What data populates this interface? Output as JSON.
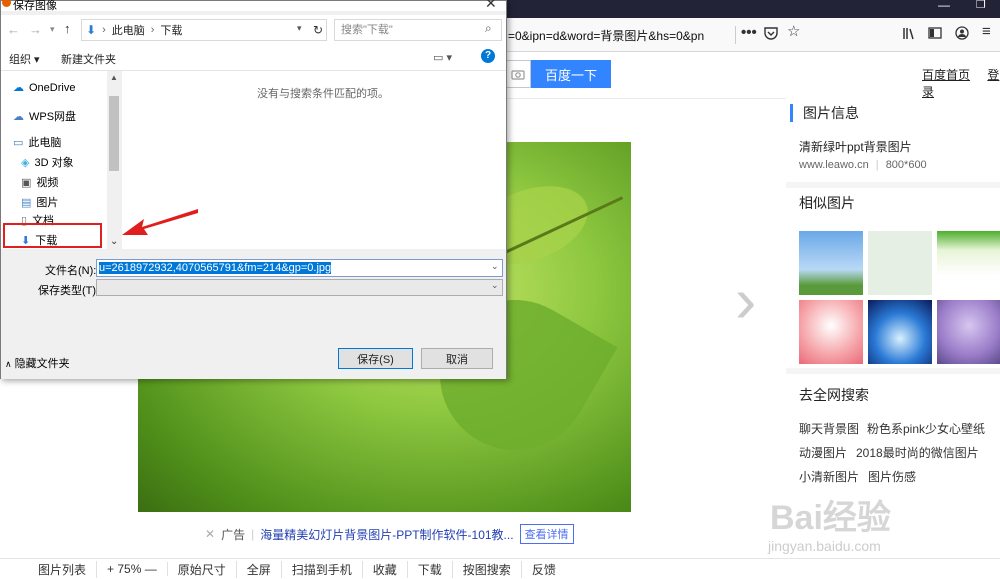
{
  "browser": {
    "url_tail": "=0&ipn=d&word=背景图片&hs=0&pn",
    "more_icon": "ellipsis-icon"
  },
  "page": {
    "search_button": "百度一下",
    "top_links": [
      "百度首页",
      "登录"
    ],
    "ad": {
      "label": "广告",
      "link": "海量精美幻灯片背景图片-PPT制作软件-101教...",
      "button": "查看详情"
    },
    "bottom_bar": [
      "图片列表",
      "+ 75% —",
      "原始尺寸",
      "全屏",
      "扫描到手机",
      "收藏",
      "下载",
      "按图搜索",
      "反馈"
    ]
  },
  "right_panel": {
    "info_title": "图片信息",
    "image_name": "清新绿叶ppt背景图片",
    "source": "www.leawo.cn",
    "size": "800*600",
    "similar_title": "相似图片",
    "search_title": "去全网搜索",
    "tags": [
      "聊天背景图",
      "粉色系pink少女心壁纸",
      "动漫图片",
      "2018最时尚的微信图片",
      "小清新图片",
      "图片伤感"
    ]
  },
  "dialog": {
    "title": "保存图像",
    "path": [
      "此电脑",
      "下载"
    ],
    "search_placeholder": "搜索\"下载\"",
    "toolbar": {
      "organize": "组织 ▾",
      "new_folder": "新建文件夹"
    },
    "nav_items": [
      "OneDrive",
      "WPS网盘",
      "此电脑",
      "3D 对象",
      "视频",
      "图片",
      "文档",
      "下载"
    ],
    "empty_message": "没有与搜索条件匹配的项。",
    "filename_label": "文件名(N):",
    "filename_value": "u=2618972932,4070565791&fm=214&gp=0.jpg",
    "filetype_label": "保存类型(T):",
    "save_button": "保存(S)",
    "cancel_button": "取消",
    "hide_folders": "隐藏文件夹"
  },
  "watermark": {
    "text": "Bai经验",
    "sub": "jingyan.baidu.com"
  }
}
